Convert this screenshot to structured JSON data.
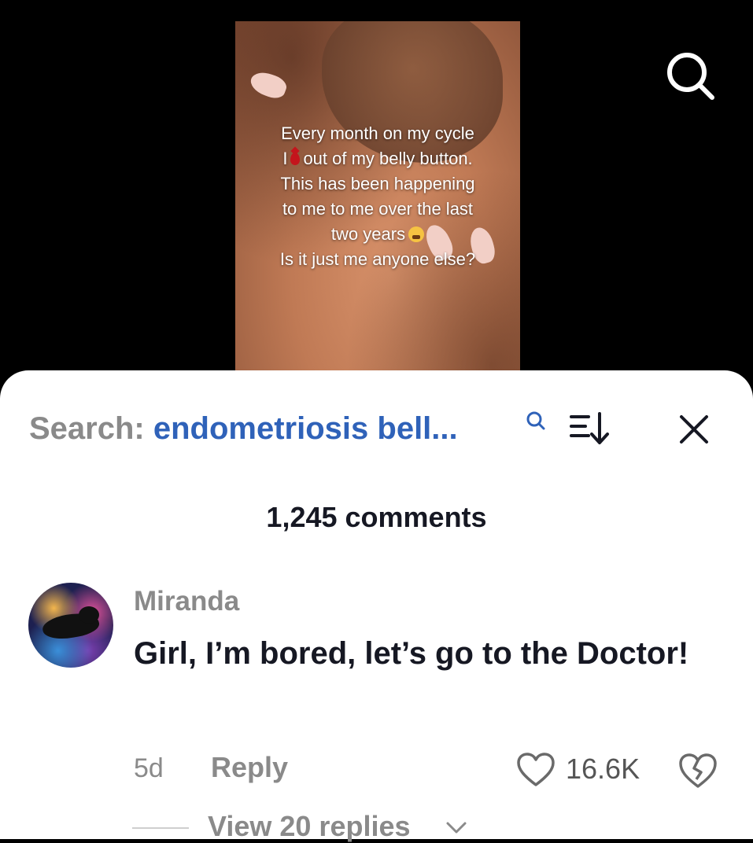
{
  "video": {
    "overlay_lines": [
      "Every month on my cycle",
      "out of my belly button.",
      "This has been happening",
      "to me to me over the last",
      "two years",
      "Is it just me anyone else?"
    ],
    "line2_prefix": "I",
    "drop_icon": "blood-drop-emoji",
    "tired_icon": "weary-face-emoji"
  },
  "header": {
    "search_icon": "search-icon"
  },
  "comments_sheet": {
    "search_prefix": "Search:",
    "search_query": "endometriosis bell...",
    "comment_count": "1,245 comments"
  },
  "comment": {
    "username": "Miranda",
    "text": "Girl, I’m bored, let’s go to the Doctor!",
    "age": "5d",
    "reply_label": "Reply",
    "likes": "16.6K",
    "view_replies": "View 20 replies"
  },
  "colors": {
    "search_query": "#2f62b9",
    "muted": "#8a8a8a",
    "text": "#161823"
  }
}
